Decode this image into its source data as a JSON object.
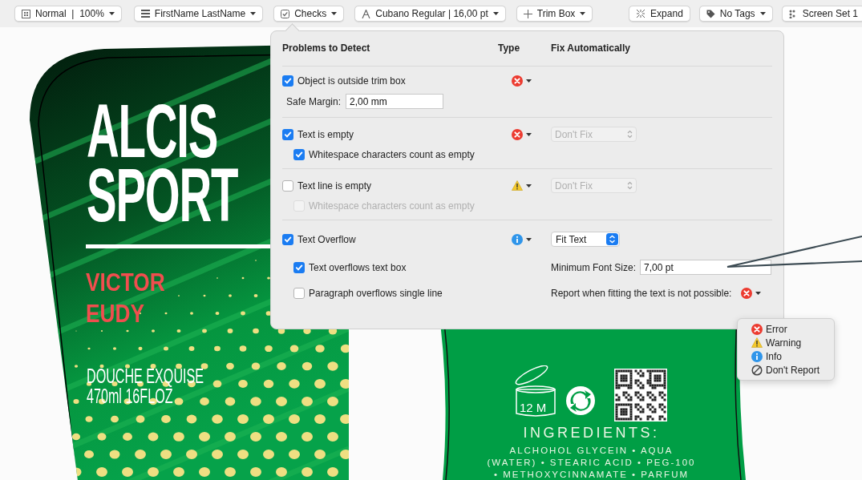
{
  "toolbar": {
    "items": [
      {
        "kind": "view",
        "label": "Normal  |  100%",
        "menu": true
      },
      {
        "kind": "user",
        "label": "FirstName LastName",
        "menu": true
      },
      {
        "kind": "checks",
        "label": "Checks",
        "menu": true
      },
      {
        "kind": "font",
        "label": "Cubano Regular | 16,00 pt",
        "menu": true
      },
      {
        "kind": "trim",
        "label": "Trim Box",
        "menu": true
      },
      {
        "kind": "expand",
        "label": "Expand",
        "menu": false
      },
      {
        "kind": "tags",
        "label": "No Tags",
        "menu": true
      },
      {
        "kind": "screens",
        "label": "Screen Set 1",
        "menu": false
      }
    ]
  },
  "popover": {
    "headers": [
      "Problems to Detect",
      "Type",
      "Fix Automatically"
    ],
    "sections": [
      {
        "label": "Object is outside trim box",
        "checked": true,
        "kind": "error",
        "options": [
          {
            "kind": "field",
            "label": "Safe Margin:",
            "value": "2,00 mm"
          }
        ]
      },
      {
        "label": "Text is empty",
        "checked": true,
        "kind": "error",
        "fix": {
          "value": "Don't Fix",
          "disabled": true
        },
        "options": [
          {
            "kind": "checkbox",
            "label": "Whitespace characters count as empty",
            "checked": true,
            "disabled": false
          }
        ]
      },
      {
        "label": "Text line is empty",
        "checked": false,
        "kind": "warning",
        "fix": {
          "value": "Don't Fix",
          "disabled": true
        },
        "options": [
          {
            "kind": "checkbox",
            "label": "Whitespace characters count as empty",
            "checked": false,
            "disabled": true
          }
        ]
      },
      {
        "label": "Text Overflow",
        "checked": true,
        "kind": "info",
        "fix": {
          "value": "Fit Text",
          "disabled": false
        },
        "options": [
          {
            "kind": "checkbox",
            "label": "Text overflows text box",
            "checked": true,
            "disabled": false
          },
          {
            "kind": "checkbox",
            "label": "Paragraph overflows single line",
            "checked": false,
            "disabled": false
          }
        ],
        "min_font_size": {
          "label": "Minimum Font Size:",
          "value": "7,00 pt"
        },
        "report": {
          "label": "Report when fitting the text is not possible:",
          "kind": "error"
        }
      }
    ]
  },
  "type_menu": {
    "items": [
      {
        "kind": "error",
        "label": "Error"
      },
      {
        "kind": "warning",
        "label": "Warning"
      },
      {
        "kind": "info",
        "label": "Info"
      },
      {
        "kind": "none",
        "label": "Don't Report"
      }
    ]
  },
  "front_label": {
    "title": [
      "ALCIS",
      "SPORT"
    ],
    "author": [
      "VICTOR",
      "EUDY"
    ],
    "product": [
      "DOUCHE EXQUISE",
      "470ml 16FLOZ"
    ]
  },
  "back_label": {
    "period": "12 M",
    "heading": "INGREDIENTS:",
    "ingredients": [
      "ALCHOHOL GLYCEIN • AQUA",
      "(WATER) • STEARIC ACID • PEG-100",
      "• METHOXYCINNAMATE • PARFUM"
    ]
  }
}
